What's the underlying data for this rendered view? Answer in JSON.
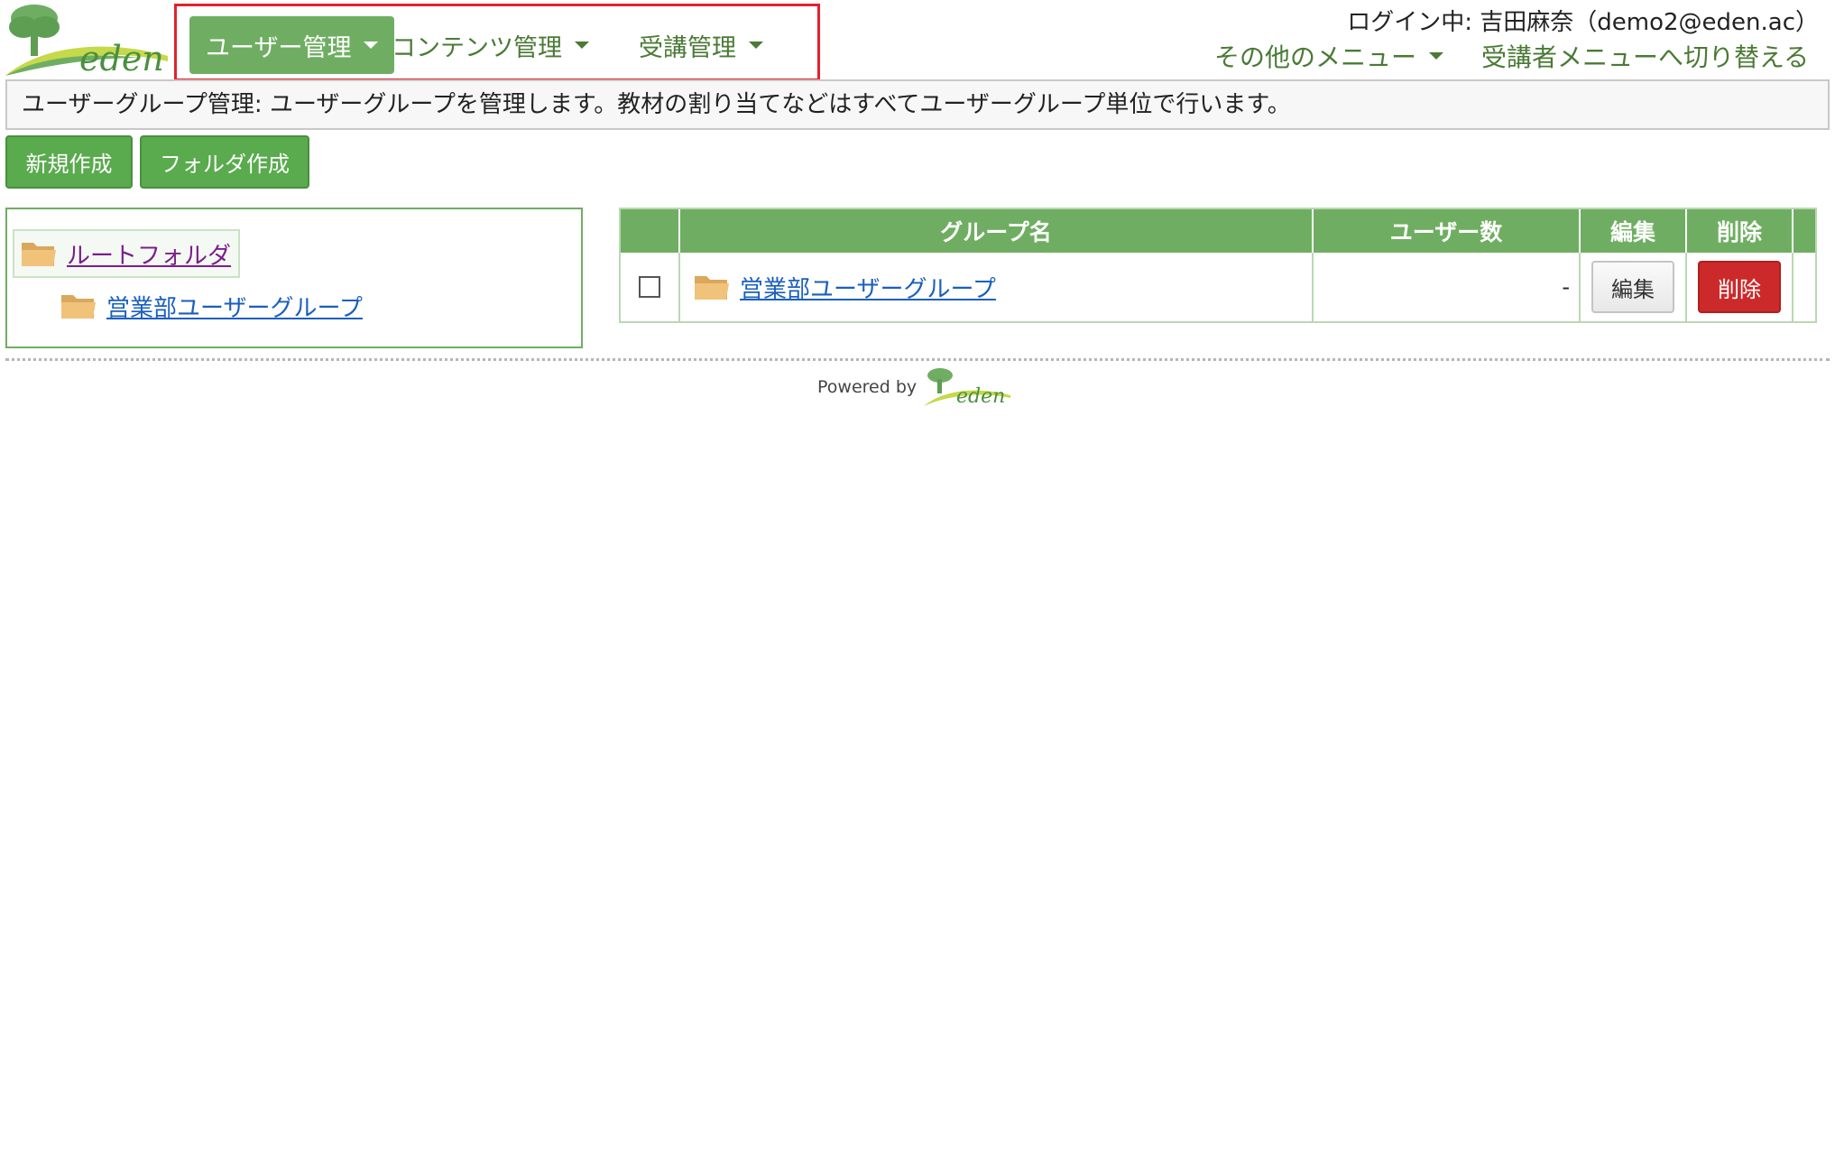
{
  "brand": {
    "logo_text": "eden"
  },
  "nav": {
    "items": [
      {
        "label": "ユーザー管理"
      },
      {
        "label": "コンテンツ管理"
      },
      {
        "label": "受講管理"
      }
    ]
  },
  "header": {
    "login_text": "ログイン中: 吉田麻奈（demo2@eden.ac）",
    "other_menu_label": "その他のメニュー",
    "switch_label": "受講者メニューへ切り替える"
  },
  "description": "ユーザーグループ管理: ユーザーグループを管理します。教材の割り当てなどはすべてユーザーグループ単位で行います。",
  "toolbar": {
    "new_label": "新規作成",
    "folder_label": "フォルダ作成"
  },
  "tree": {
    "root_label": "ルートフォルダ",
    "children": [
      {
        "label": "営業部ユーザーグループ"
      }
    ]
  },
  "table": {
    "headers": {
      "name": "グループ名",
      "users": "ユーザー数",
      "edit": "編集",
      "delete": "削除"
    },
    "rows": [
      {
        "name": "営業部ユーザーグループ",
        "users": "-",
        "edit_label": "編集",
        "delete_label": "削除"
      }
    ]
  },
  "footer": {
    "powered_text": "Powered by",
    "logo_text": "eden"
  },
  "colors": {
    "brand_green": "#6fae62",
    "button_green": "#5aaa4e",
    "nav_text": "#4a7a35",
    "danger": "#cc2a2a",
    "highlight": "#e0222c"
  }
}
